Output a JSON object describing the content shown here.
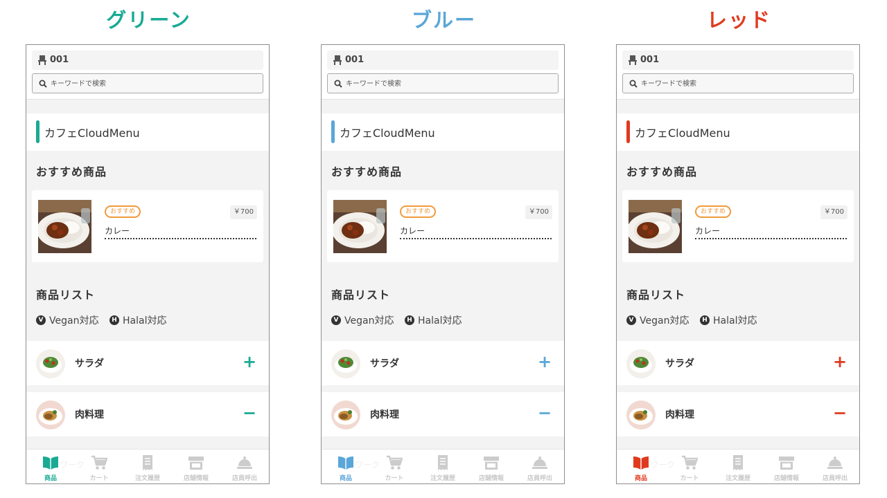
{
  "variants": [
    {
      "title": "グリーン",
      "accent": "#1aaa94",
      "table_no": "001",
      "search_placeholder": "キーワードで検索",
      "shop_name": "カフェCloudMenu",
      "recommended_title": "おすすめ商品",
      "recommended_item": {
        "badge": "おすすめ",
        "price": "￥700",
        "name": "カレー"
      },
      "list_title": "商品リスト",
      "legend": [
        {
          "mark": "V",
          "label": "Vegan対応"
        },
        {
          "mark": "H",
          "label": "Halal対応"
        }
      ],
      "categories": [
        {
          "name": "サラダ",
          "toggle": "+"
        },
        {
          "name": "肉料理",
          "toggle": "−"
        }
      ],
      "ghost_text": "ワーク",
      "nav": [
        {
          "label": "商品",
          "icon": "book-icon"
        },
        {
          "label": "カート",
          "icon": "cart-icon"
        },
        {
          "label": "注文履歴",
          "icon": "receipt-icon"
        },
        {
          "label": "店舗情報",
          "icon": "store-icon"
        },
        {
          "label": "店員呼出",
          "icon": "bell-icon"
        }
      ]
    },
    {
      "title": "ブルー",
      "accent": "#5aa6d8",
      "table_no": "001",
      "search_placeholder": "キーワードで検索",
      "shop_name": "カフェCloudMenu",
      "recommended_title": "おすすめ商品",
      "recommended_item": {
        "badge": "おすすめ",
        "price": "￥700",
        "name": "カレー"
      },
      "list_title": "商品リスト",
      "legend": [
        {
          "mark": "V",
          "label": "Vegan対応"
        },
        {
          "mark": "H",
          "label": "Halal対応"
        }
      ],
      "categories": [
        {
          "name": "サラダ",
          "toggle": "+"
        },
        {
          "name": "肉料理",
          "toggle": "−"
        }
      ],
      "ghost_text": "ワーク",
      "nav": [
        {
          "label": "商品",
          "icon": "book-icon"
        },
        {
          "label": "カート",
          "icon": "cart-icon"
        },
        {
          "label": "注文履歴",
          "icon": "receipt-icon"
        },
        {
          "label": "店舗情報",
          "icon": "store-icon"
        },
        {
          "label": "店員呼出",
          "icon": "bell-icon"
        }
      ]
    },
    {
      "title": "レッド",
      "accent": "#e03a1e",
      "table_no": "001",
      "search_placeholder": "キーワードで検索",
      "shop_name": "カフェCloudMenu",
      "recommended_title": "おすすめ商品",
      "recommended_item": {
        "badge": "おすすめ",
        "price": "￥700",
        "name": "カレー"
      },
      "list_title": "商品リスト",
      "legend": [
        {
          "mark": "V",
          "label": "Vegan対応"
        },
        {
          "mark": "H",
          "label": "Halal対応"
        }
      ],
      "categories": [
        {
          "name": "サラダ",
          "toggle": "+"
        },
        {
          "name": "肉料理",
          "toggle": "−"
        }
      ],
      "ghost_text": "ワーク",
      "nav": [
        {
          "label": "商品",
          "icon": "book-icon"
        },
        {
          "label": "カート",
          "icon": "cart-icon"
        },
        {
          "label": "注文履歴",
          "icon": "receipt-icon"
        },
        {
          "label": "店舗情報",
          "icon": "store-icon"
        },
        {
          "label": "店員呼出",
          "icon": "bell-icon"
        }
      ]
    }
  ]
}
